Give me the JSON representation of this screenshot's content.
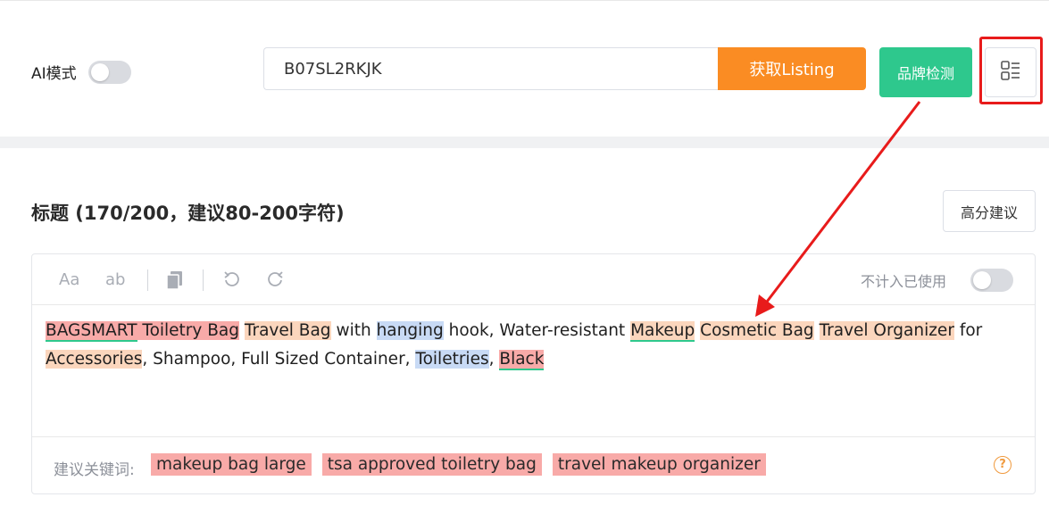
{
  "header": {
    "ai_mode_label": "AI模式",
    "asin_value": "B07SL2RKJK",
    "fetch_button": "获取Listing",
    "brand_button": "品牌检测"
  },
  "title_section": {
    "heading": "标题 (170/200，建议80-200字符)",
    "score_button": "高分建议",
    "toolbar": {
      "btn_aa": "Aa",
      "btn_ab": "ab",
      "non_count_label": "不计入已使用"
    },
    "tokens": [
      {
        "text": "BAGSMART Toiletry Bag",
        "hl": "red",
        "ul": false,
        "parts": [
          {
            "text": "BAGSMART",
            "ul": true
          },
          {
            "text": " Toiletry Bag",
            "ul": false
          }
        ]
      },
      {
        "text": " ",
        "hl": ""
      },
      {
        "text": "Travel Bag",
        "hl": "org"
      },
      {
        "text": " with ",
        "hl": ""
      },
      {
        "text": "hanging",
        "hl": "blue"
      },
      {
        "text": " hook, Water-resistant ",
        "hl": ""
      },
      {
        "text": "Makeup",
        "hl": "org",
        "ul": true
      },
      {
        "text": " ",
        "hl": ""
      },
      {
        "text": "Cosmetic Bag",
        "hl": "org"
      },
      {
        "text": " ",
        "hl": ""
      },
      {
        "text": "Travel Organizer",
        "hl": "org"
      },
      {
        "text": " for ",
        "hl": ""
      },
      {
        "text": "Accessories",
        "hl": "org"
      },
      {
        "text": ", Shampoo, Full Sized Container, ",
        "hl": ""
      },
      {
        "text": "Toiletries",
        "hl": "blue"
      },
      {
        "text": ", ",
        "hl": ""
      },
      {
        "text": "Black",
        "hl": "red",
        "ul": true
      }
    ],
    "keywords_label": "建议关键词:",
    "keywords": [
      "makeup bag large",
      "tsa approved toiletry bag",
      "travel makeup organizer"
    ],
    "help_glyph": "?"
  },
  "colors": {
    "accent_orange": "#fa8c23",
    "accent_green": "#2ec88d",
    "highlight_red": "#f8aaa8",
    "highlight_orange": "#fbd6bd",
    "highlight_blue": "#c8daf5",
    "annotation_red": "#e81b1b"
  },
  "icons": [
    "list-view-icon",
    "copy-icon",
    "undo-icon",
    "redo-icon",
    "help-icon",
    "annotation-arrow"
  ]
}
